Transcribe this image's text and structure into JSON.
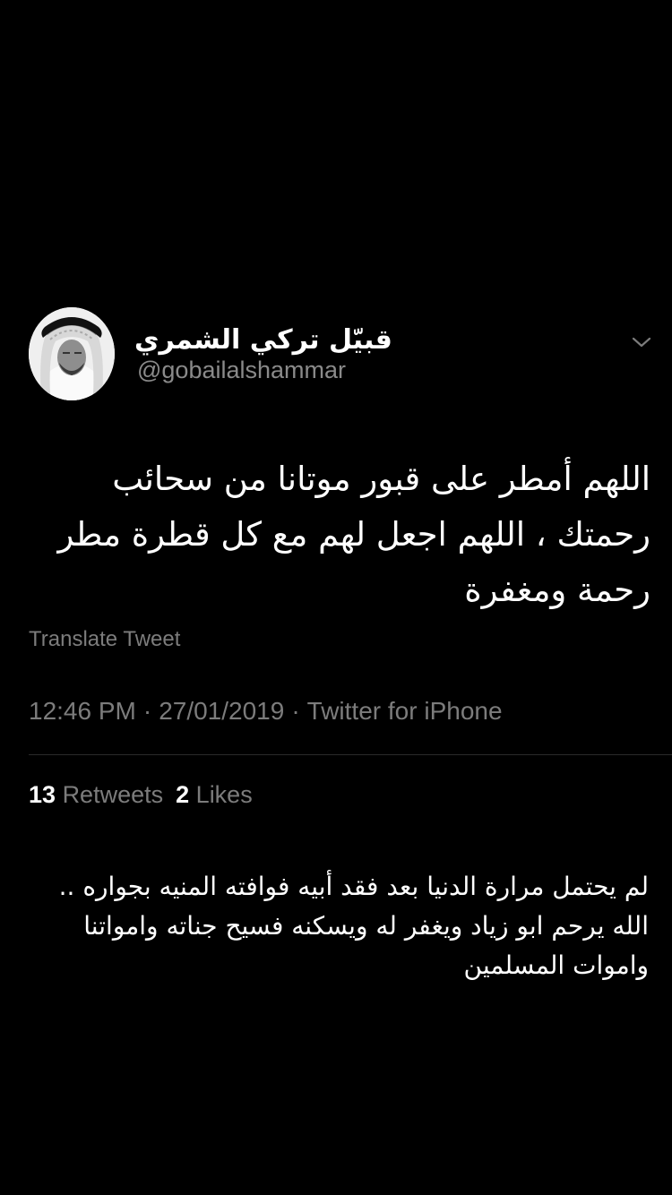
{
  "tweet": {
    "author": {
      "display_name": "قبيّل تركي الشمري",
      "handle": "@gobailalshammar"
    },
    "text": "اللهم أمطر على قبور موتانا من سحائب رحمتك ، اللهم اجعل لهم مع كل قطرة مطر رحمة ومغفرة",
    "translate_label": "Translate Tweet",
    "time": "12:46 PM",
    "date": "27/01/2019",
    "source": "Twitter for iPhone",
    "separator": "·",
    "stats": {
      "retweets_count": "13",
      "retweets_label": "Retweets",
      "likes_count": "2",
      "likes_label": "Likes"
    },
    "more_icon": "chevron-down-icon"
  },
  "caption": "لم يحتمل مرارة الدنيا بعد فقد أبيه فوافته المنيه بجواره .. الله يرحم ابو زياد ويغفر له ويسكنه فسيح جناته وامواتنا واموات المسلمين",
  "colors": {
    "background": "#000000",
    "primary_text": "#ffffff",
    "secondary_text": "#7c7c7c"
  }
}
